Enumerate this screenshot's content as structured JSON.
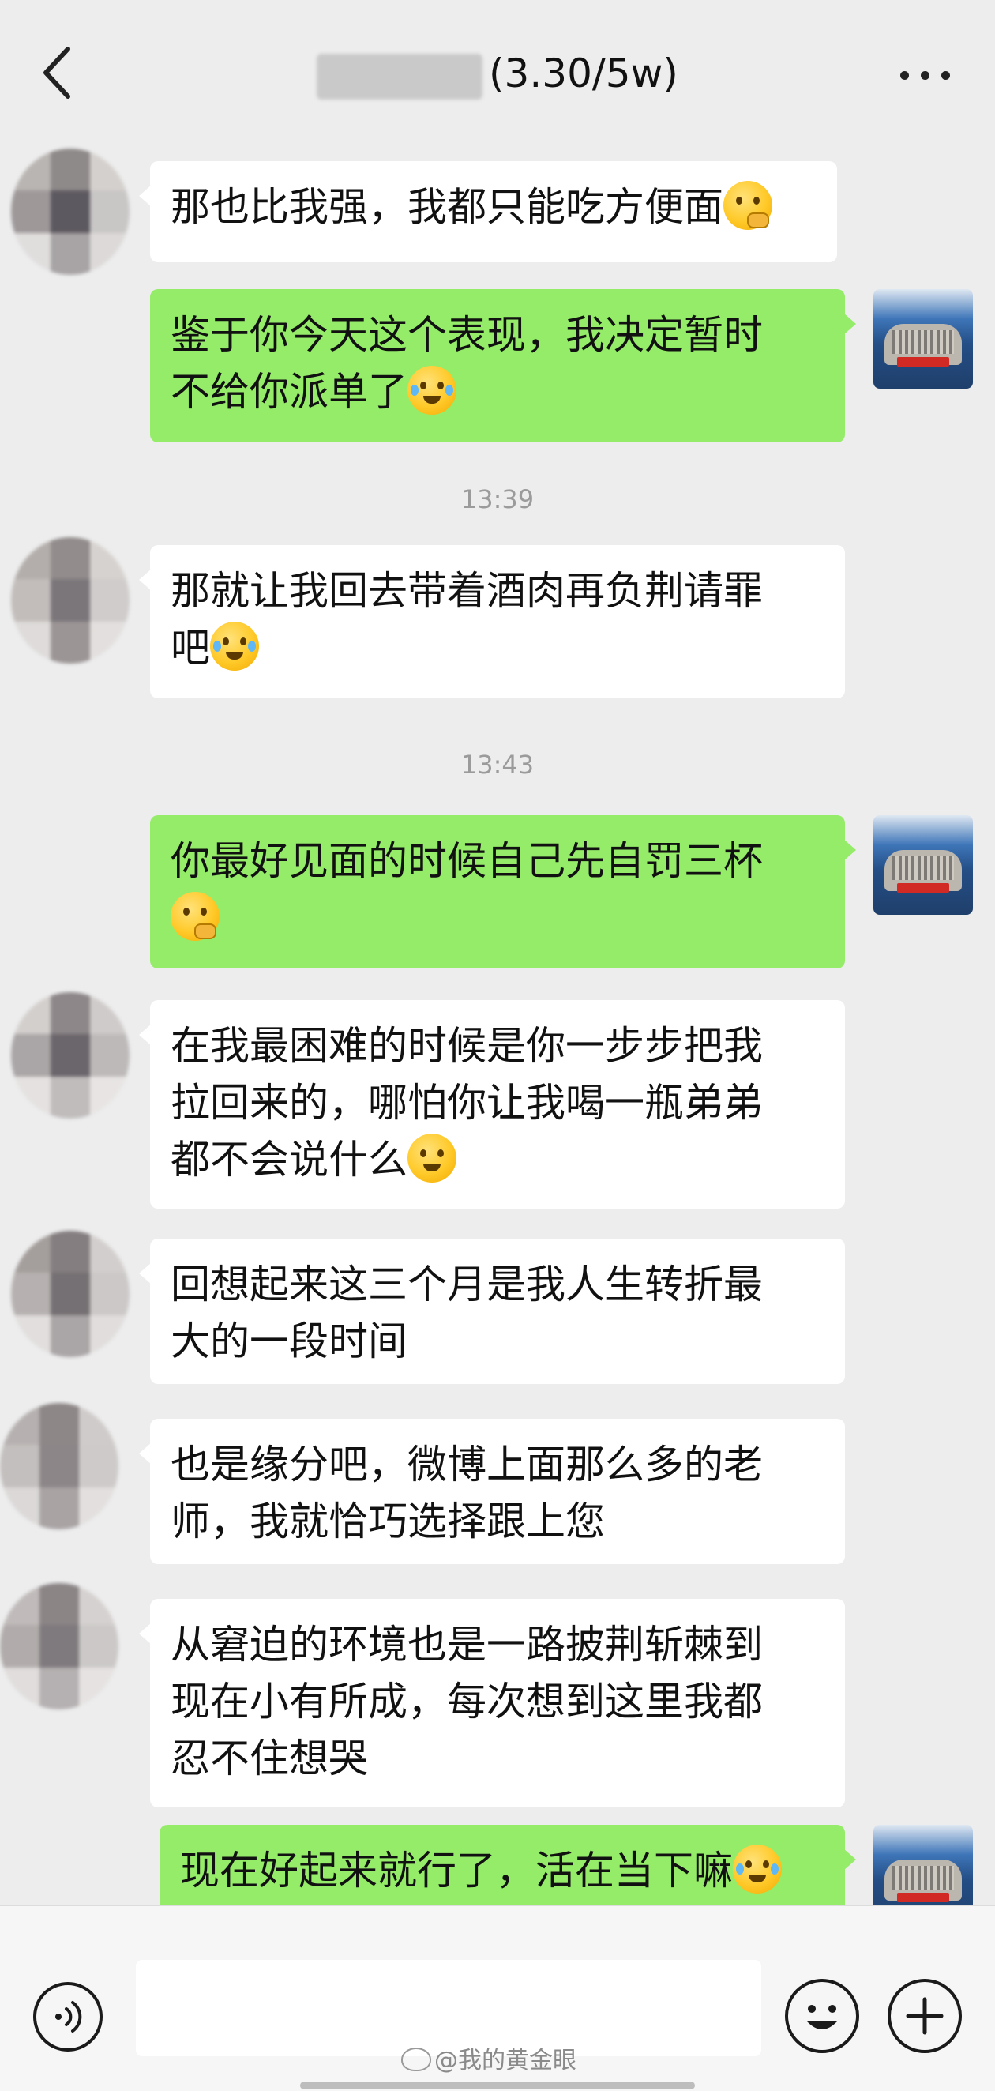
{
  "header": {
    "title_suffix": "(3.30/5w)",
    "back_icon": "chevron-left-icon",
    "more_icon": "more-dots-icon"
  },
  "messages": [
    {
      "side": "in",
      "text": "那也比我强，我都只能吃方便面",
      "emoji": "thinking-hand-emoji"
    },
    {
      "side": "out",
      "text": "鉴于你今天这个表现，我决定暂时\n不给你派单了",
      "emoji": "laughing-tears-emoji"
    },
    {
      "timestamp": "13:39"
    },
    {
      "side": "in",
      "text": "那就让我回去带着酒肉再负荆请罪\n吧",
      "emoji": "laughing-tears-emoji"
    },
    {
      "timestamp": "13:43"
    },
    {
      "side": "out",
      "text": "你最好见面的时候自己先自罚三杯\n",
      "emoji": "thinking-hand-emoji"
    },
    {
      "side": "in",
      "text": "在我最困难的时候是你一步步把我\n拉回来的，哪怕你让我喝一瓶弟弟\n都不会说什么",
      "emoji": "smile-emoji"
    },
    {
      "side": "in",
      "text": "回想起来这三个月是我人生转折最\n大的一段时间"
    },
    {
      "side": "in",
      "text": "也是缘分吧，微博上面那么多的老\n师，我就恰巧选择跟上您"
    },
    {
      "side": "in",
      "text": "从窘迫的环境也是一路披荆斩棘到\n现在小有所成，每次想到这里我都\n忍不住想哭"
    },
    {
      "side": "out",
      "text": "现在好起来就行了，活在当下嘛",
      "emoji": "laughing-tears-emoji"
    }
  ],
  "input_bar": {
    "voice_icon": "voice-icon",
    "emoji_icon": "emoji-icon",
    "plus_icon": "plus-icon",
    "input_placeholder": ""
  },
  "watermark": "@我的黄金眼",
  "colors": {
    "background": "#ededed",
    "incoming_bubble": "#ffffff",
    "outgoing_bubble": "#95ec69",
    "timestamp": "#9b9b9b"
  }
}
